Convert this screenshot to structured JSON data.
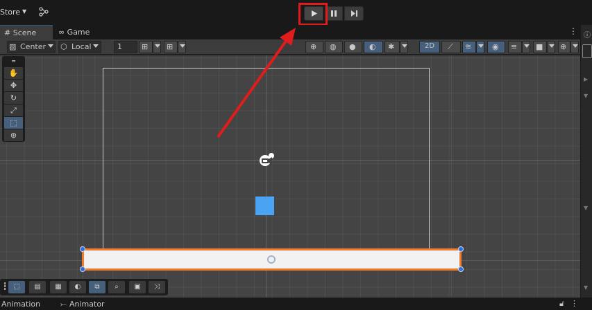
{
  "topbar": {
    "store_label": "Store"
  },
  "tabs": {
    "scene_label": "Scene",
    "game_label": "Game"
  },
  "toolbar": {
    "pivot_label": "Center",
    "space_label": "Local",
    "grid_value": "1",
    "mode_2d_label": "2D"
  },
  "bottom": {
    "animation_label": "Animation",
    "animator_label": "Animator"
  },
  "colors": {
    "accent_blue": "#4aa3f3",
    "selection_orange": "#f07d27",
    "annotation_red": "#e11c1c",
    "active_button": "#46607c"
  }
}
